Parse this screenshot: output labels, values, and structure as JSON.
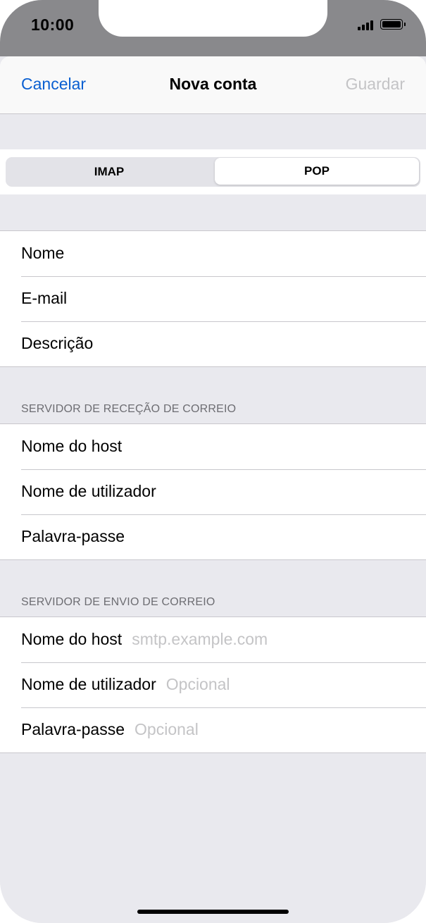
{
  "status": {
    "time": "10:00"
  },
  "nav": {
    "cancel": "Cancelar",
    "title": "Nova conta",
    "save": "Guardar"
  },
  "segments": {
    "left": "IMAP",
    "right": "POP",
    "selected": "POP"
  },
  "account": {
    "name_label": "Nome",
    "email_label": "E-mail",
    "description_label": "Descrição"
  },
  "incoming": {
    "header": "SERVIDOR DE RECEÇÃO DE CORREIO",
    "host_label": "Nome do host",
    "user_label": "Nome de utilizador",
    "password_label": "Palavra-passe"
  },
  "outgoing": {
    "header": "SERVIDOR DE ENVIO DE CORREIO",
    "host_label": "Nome do host",
    "host_placeholder": "smtp.example.com",
    "user_label": "Nome de utilizador",
    "user_placeholder": "Opcional",
    "password_label": "Palavra-passe",
    "password_placeholder": "Opcional"
  },
  "colors": {
    "accent": "#0a5fd1",
    "placeholder": "#c4c4c6",
    "background": "#e9e9ee"
  }
}
